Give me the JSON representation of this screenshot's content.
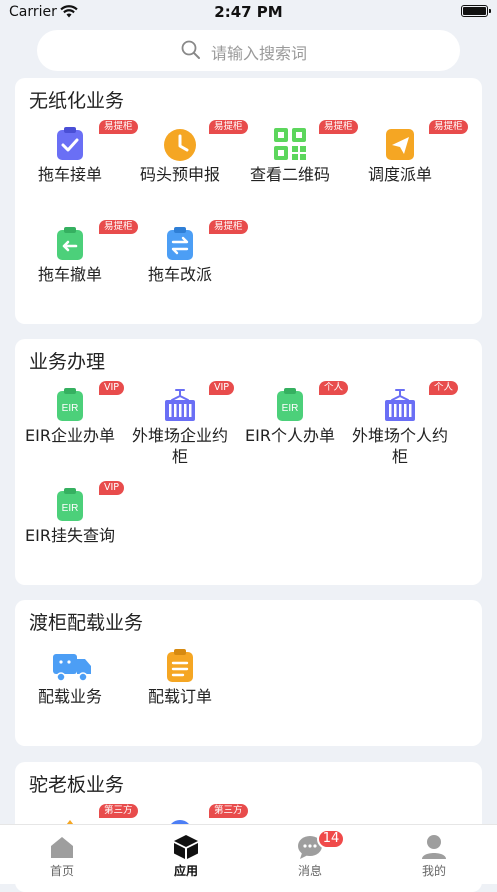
{
  "status_bar": {
    "carrier": "Carrier",
    "time": "2:47 PM"
  },
  "search": {
    "placeholder": "请输入搜索词"
  },
  "sections": [
    {
      "title": "无纸化业务",
      "items": [
        {
          "label": "拖车接单",
          "badge": "易提柜",
          "icon": "clipboard-check-icon",
          "color": "#6a6ff5"
        },
        {
          "label": "码头预申报",
          "badge": "易提柜",
          "icon": "clock-icon",
          "color": "#f5a623"
        },
        {
          "label": "查看二维码",
          "badge": "易提柜",
          "icon": "qr-code-icon",
          "color": "#5cd65c"
        },
        {
          "label": "调度派单",
          "badge": "易提柜",
          "icon": "send-plane-icon",
          "color": "#f5a623"
        },
        {
          "label": "拖车撤单",
          "badge": "易提柜",
          "icon": "undo-clipboard-icon",
          "color": "#4cd07a"
        },
        {
          "label": "拖车改派",
          "badge": "易提柜",
          "icon": "swap-clipboard-icon",
          "color": "#4c9ef5"
        }
      ]
    },
    {
      "title": "业务办理",
      "items": [
        {
          "label": "EIR企业办单",
          "badge": "VIP",
          "icon": "eir-document-icon",
          "color": "#4cd07a"
        },
        {
          "label": "外堆场企业约柜",
          "badge": "VIP",
          "icon": "container-icon",
          "color": "#6a6ff5"
        },
        {
          "label": "EIR个人办单",
          "badge": "个人",
          "icon": "eir-document-icon",
          "color": "#4cd07a"
        },
        {
          "label": "外堆场个人约柜",
          "badge": "个人",
          "icon": "container-icon",
          "color": "#6a6ff5"
        },
        {
          "label": "EIR挂失查询",
          "badge": "VIP",
          "icon": "eir-document-icon",
          "color": "#4cd07a"
        }
      ]
    },
    {
      "title": "渡柜配载业务",
      "items": [
        {
          "label": "配载业务",
          "icon": "truck-icon",
          "color": "#4c9ef5"
        },
        {
          "label": "配载订单",
          "icon": "order-list-icon",
          "color": "#f5a623"
        }
      ]
    },
    {
      "title": "驼老板业务",
      "items": [
        {
          "label": "",
          "badge": "第三方",
          "icon": "partner-icon",
          "color": "#f5a623"
        },
        {
          "label": "",
          "badge": "第三方",
          "icon": "partner-icon",
          "color": "#4c7ef5"
        }
      ]
    }
  ],
  "tab_bar": {
    "tabs": [
      {
        "label": "首页",
        "icon": "home-icon"
      },
      {
        "label": "应用",
        "icon": "box-icon",
        "active": true
      },
      {
        "label": "消息",
        "icon": "message-icon",
        "badge": "14"
      },
      {
        "label": "我的",
        "icon": "user-icon"
      }
    ]
  }
}
